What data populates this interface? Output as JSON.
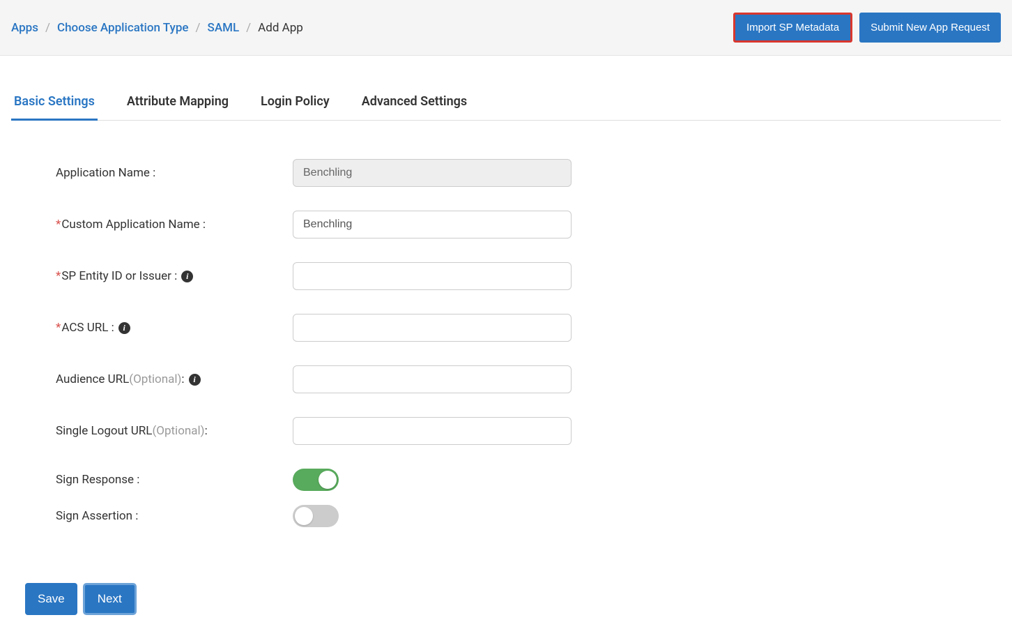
{
  "breadcrumb": {
    "apps": "Apps",
    "choose_type": "Choose Application Type",
    "saml": "SAML",
    "current": "Add App"
  },
  "header_buttons": {
    "import_metadata": "Import SP Metadata",
    "submit_request": "Submit New App Request"
  },
  "tabs": {
    "basic": "Basic Settings",
    "attribute": "Attribute Mapping",
    "login": "Login Policy",
    "advanced": "Advanced Settings"
  },
  "form": {
    "app_name_label": "Application Name :",
    "app_name_value": "Benchling",
    "custom_name_label": "Custom Application Name :",
    "custom_name_value": "Benchling",
    "sp_entity_label": "SP Entity ID or Issuer :",
    "sp_entity_value": "",
    "acs_url_label": "ACS URL :",
    "acs_url_value": "",
    "audience_label": "Audience URL ",
    "audience_optional": "(Optional)",
    "audience_colon": " :",
    "audience_value": "",
    "logout_label": "Single Logout URL ",
    "logout_optional": "(Optional)",
    "logout_colon": " :",
    "logout_value": "",
    "sign_response_label": "Sign Response :",
    "sign_assertion_label": "Sign Assertion :"
  },
  "footer": {
    "save": "Save",
    "next": "Next"
  }
}
